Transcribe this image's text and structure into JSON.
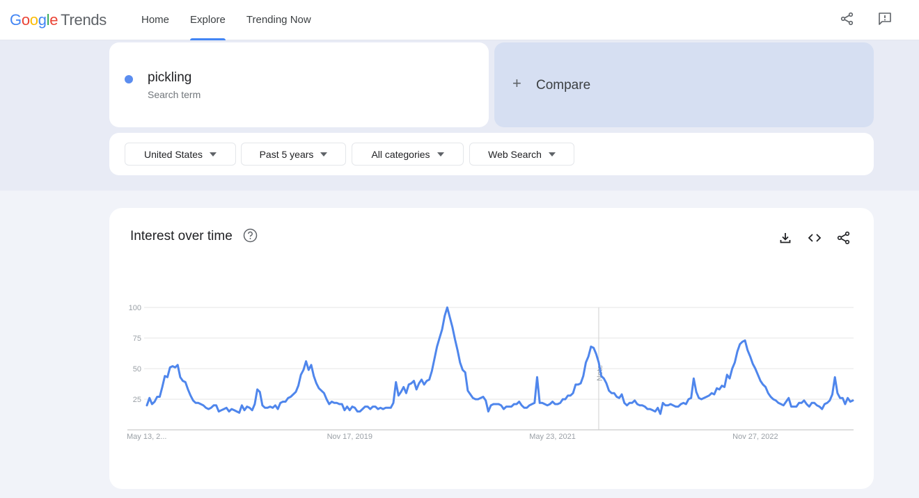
{
  "header": {
    "logo_google": "Google",
    "logo_product": "Trends",
    "nav": [
      {
        "label": "Home",
        "active": false
      },
      {
        "label": "Explore",
        "active": true
      },
      {
        "label": "Trending Now",
        "active": false
      }
    ],
    "icons": [
      "share-icon",
      "feedback-icon"
    ]
  },
  "search": {
    "term": "pickling",
    "term_type": "Search term",
    "term_color": "#5b8def",
    "compare_label": "Compare"
  },
  "filters": [
    {
      "label": "United States"
    },
    {
      "label": "Past 5 years"
    },
    {
      "label": "All categories"
    },
    {
      "label": "Web Search"
    }
  ],
  "interest_card": {
    "title": "Interest over time",
    "actions": [
      "download-icon",
      "embed-icon",
      "share-icon"
    ]
  },
  "chart_data": {
    "type": "line",
    "title": "Interest over time",
    "xlabel": "",
    "ylabel": "",
    "ylim": [
      0,
      100
    ],
    "yticks": [
      25,
      50,
      75,
      100
    ],
    "grid": true,
    "x_tick_labels": [
      "May 13, 2...",
      "Nov 17, 2019",
      "May 23, 2021",
      "Nov 27, 2022"
    ],
    "x_tick_positions_week": [
      0,
      79,
      158,
      237
    ],
    "annotation": {
      "label": "Note",
      "week": 176
    },
    "series": [
      {
        "name": "pickling",
        "color": "#4f86ec",
        "values": [
          20,
          26,
          21,
          23,
          27,
          27,
          35,
          44,
          43,
          51,
          52,
          51,
          53,
          43,
          40,
          39,
          33,
          28,
          24,
          22,
          22,
          21,
          20,
          18,
          17,
          18,
          20,
          20,
          15,
          16,
          17,
          18,
          15,
          17,
          16,
          15,
          14,
          20,
          16,
          19,
          18,
          16,
          21,
          33,
          31,
          20,
          18,
          18,
          19,
          18,
          20,
          17,
          22,
          23,
          23,
          26,
          27,
          29,
          31,
          36,
          45,
          49,
          56,
          49,
          53,
          44,
          38,
          34,
          32,
          30,
          25,
          21,
          23,
          22,
          22,
          21,
          21,
          16,
          19,
          16,
          19,
          18,
          15,
          15,
          17,
          19,
          19,
          17,
          19,
          19,
          17,
          18,
          17,
          18,
          18,
          18,
          22,
          39,
          28,
          31,
          35,
          30,
          37,
          38,
          40,
          33,
          38,
          41,
          37,
          40,
          41,
          48,
          58,
          68,
          75,
          82,
          93,
          100,
          92,
          84,
          74,
          65,
          55,
          49,
          47,
          32,
          29,
          26,
          25,
          25,
          26,
          27,
          24,
          15,
          20,
          21,
          21,
          21,
          20,
          17,
          19,
          19,
          19,
          21,
          21,
          23,
          20,
          18,
          18,
          20,
          21,
          22,
          43,
          22,
          22,
          21,
          20,
          21,
          23,
          21,
          21,
          22,
          25,
          25,
          28,
          28,
          30,
          37,
          37,
          38,
          44,
          55,
          60,
          68,
          67,
          62,
          55,
          44,
          42,
          38,
          32,
          30,
          30,
          27,
          26,
          29,
          22,
          20,
          22,
          22,
          24,
          21,
          20,
          20,
          19,
          17,
          17,
          16,
          15,
          18,
          13,
          22,
          20,
          20,
          21,
          20,
          19,
          19,
          21,
          22,
          21,
          25,
          26,
          42,
          31,
          26,
          25,
          26,
          27,
          28,
          30,
          29,
          34,
          33,
          36,
          35,
          45,
          42,
          50,
          55,
          64,
          70,
          72,
          73,
          65,
          60,
          54,
          50,
          45,
          40,
          37,
          35,
          30,
          27,
          25,
          24,
          22,
          21,
          20,
          23,
          26,
          19,
          19,
          19,
          22,
          22,
          24,
          21,
          19,
          22,
          22,
          20,
          19,
          17,
          21,
          22,
          24,
          29,
          43,
          30,
          26,
          26,
          21,
          26,
          23,
          24
        ]
      }
    ]
  }
}
